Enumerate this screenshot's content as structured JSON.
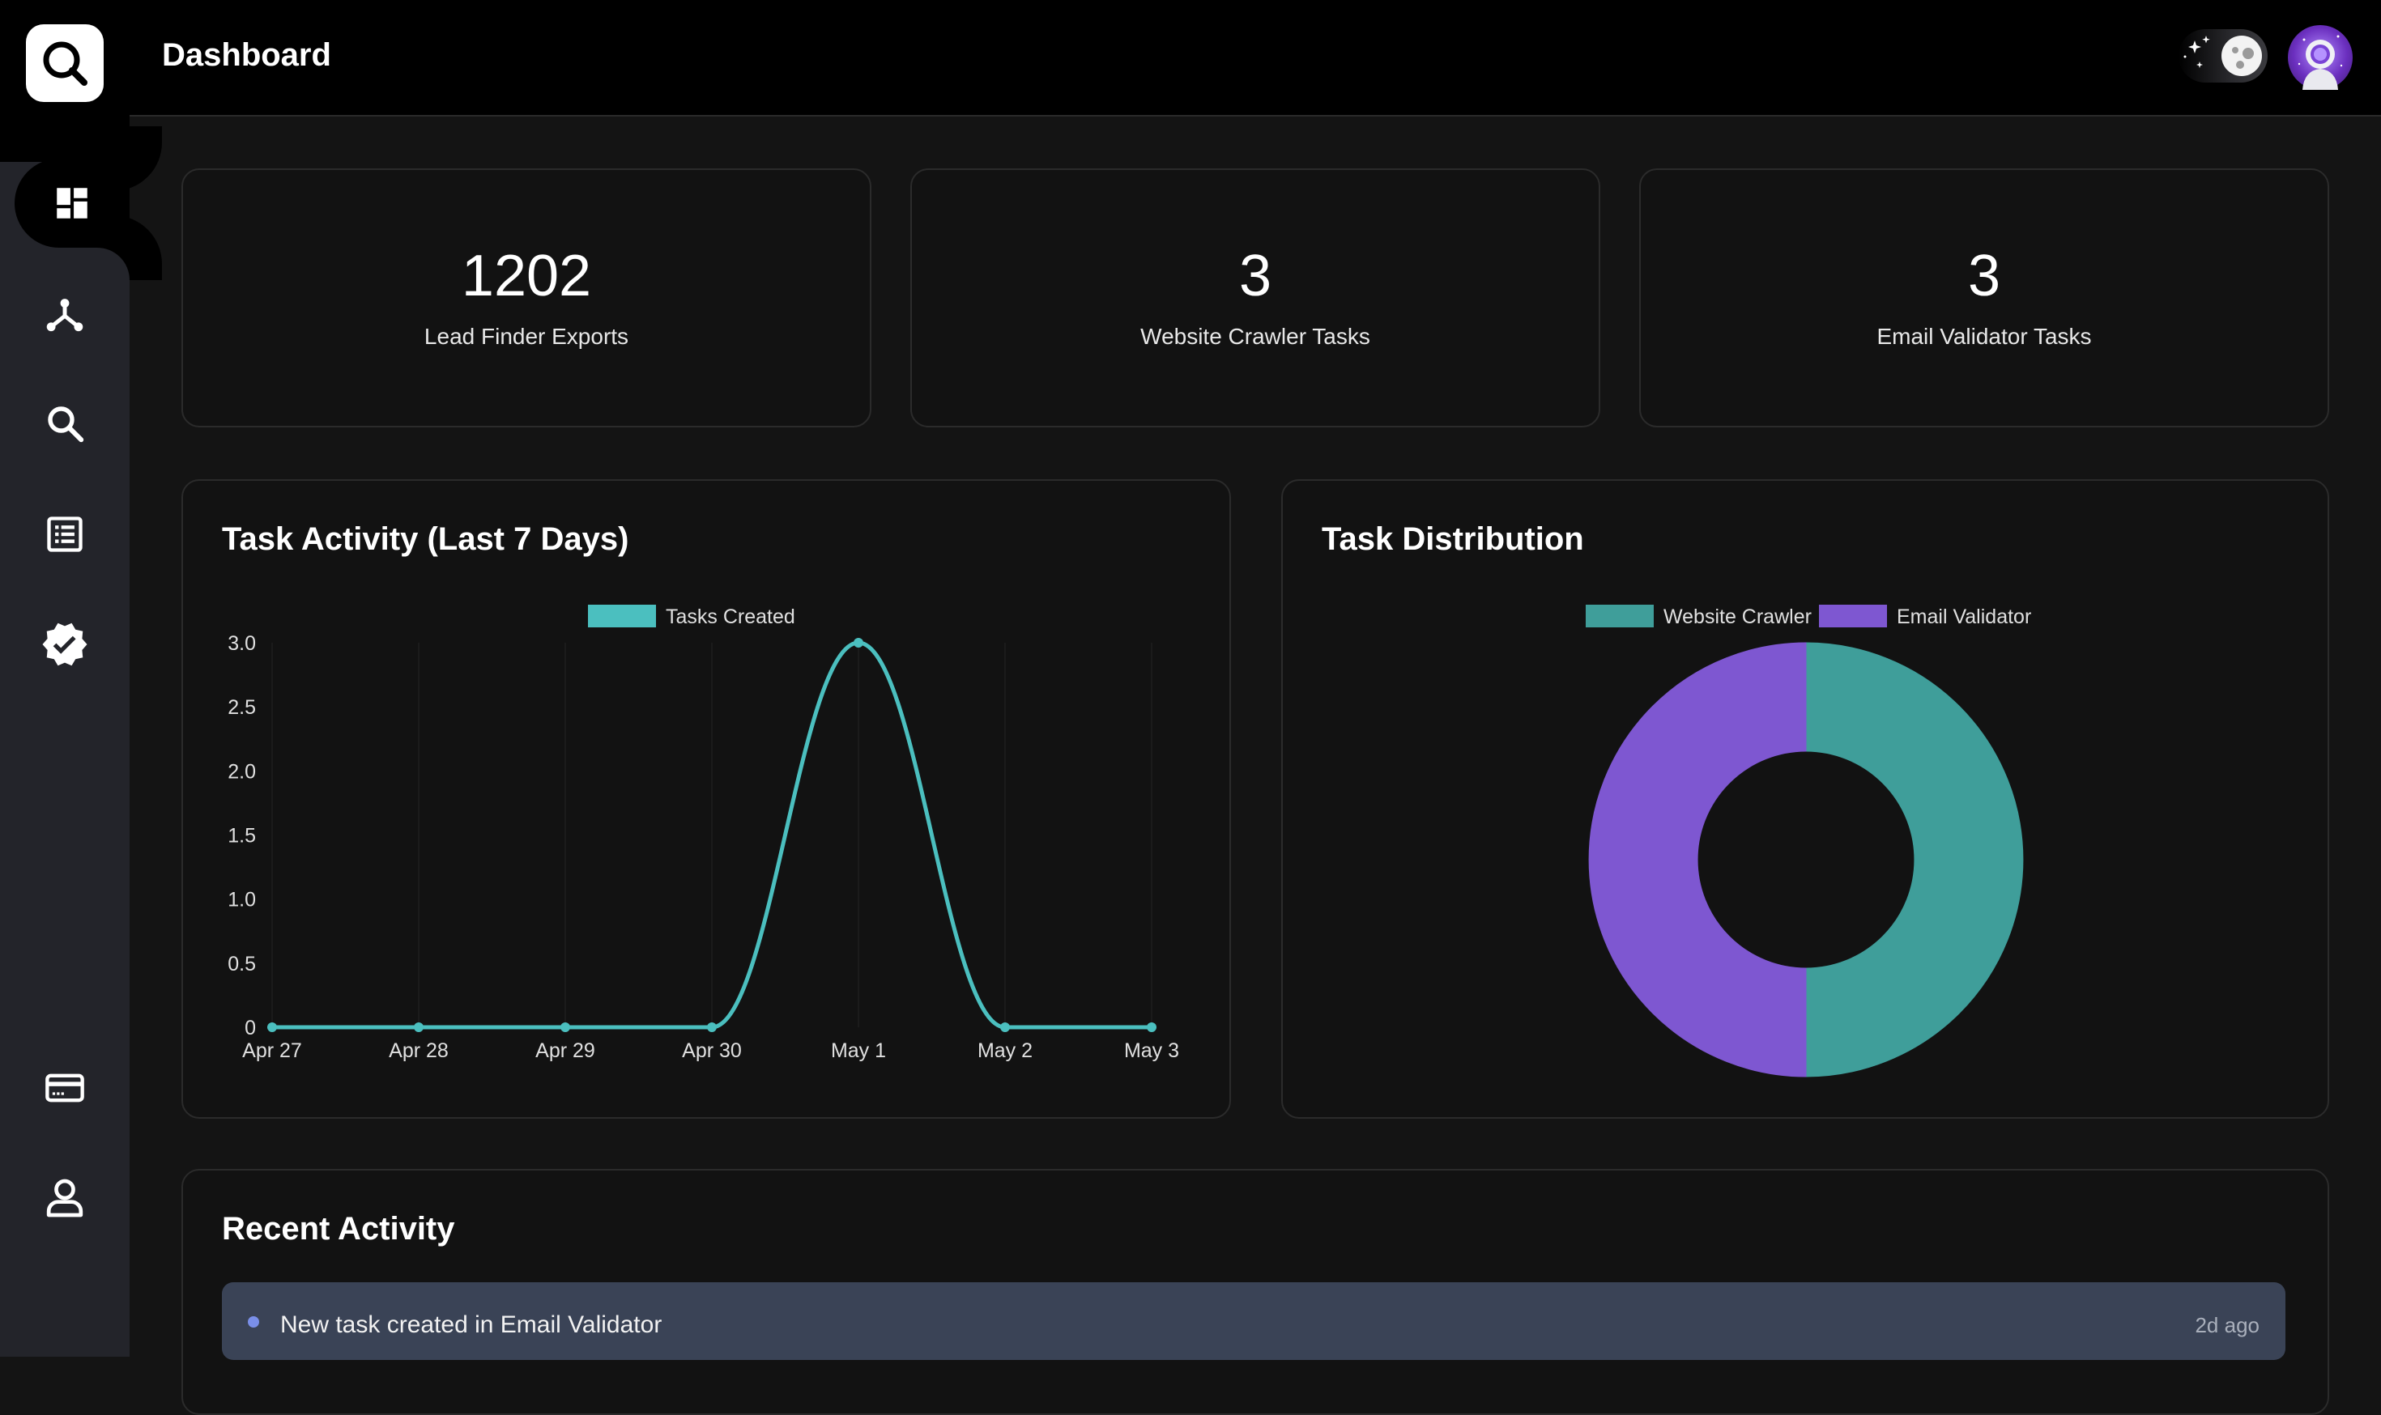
{
  "header": {
    "title": "Dashboard"
  },
  "sidebar": {
    "items": [
      {
        "name": "dashboard",
        "icon": "dashboard-icon",
        "active": true
      },
      {
        "name": "integrations",
        "icon": "network-icon"
      },
      {
        "name": "lead-finder",
        "icon": "search-icon"
      },
      {
        "name": "website-crawler",
        "icon": "list-icon"
      },
      {
        "name": "email-validator",
        "icon": "verified-badge-icon"
      },
      {
        "name": "billing",
        "icon": "credit-card-icon"
      },
      {
        "name": "account",
        "icon": "user-icon"
      }
    ]
  },
  "stats": [
    {
      "value": "1202",
      "label": "Lead Finder Exports"
    },
    {
      "value": "3",
      "label": "Website Crawler Tasks"
    },
    {
      "value": "3",
      "label": "Email Validator Tasks"
    }
  ],
  "activity_chart": {
    "title": "Task Activity (Last 7 Days)"
  },
  "distribution_chart": {
    "title": "Task Distribution"
  },
  "recent": {
    "title": "Recent Activity",
    "items": [
      {
        "text": "New task created in Email Validator",
        "time": "2d ago"
      }
    ]
  },
  "colors": {
    "teal": "#3f9e9a",
    "line": "#4bbfbf",
    "purple": "#7e57d1"
  },
  "chart_data": [
    {
      "type": "line",
      "title": "Task Activity (Last 7 Days)",
      "x": [
        "Apr 27",
        "Apr 28",
        "Apr 29",
        "Apr 30",
        "May 1",
        "May 2",
        "May 3"
      ],
      "series": [
        {
          "name": "Tasks Created",
          "values": [
            0,
            0,
            0,
            0,
            3,
            0,
            0
          ]
        }
      ],
      "yticks": [
        "0",
        "0.5",
        "1.0",
        "1.5",
        "2.0",
        "2.5",
        "3.0"
      ],
      "ylim": [
        0,
        3
      ],
      "legend": "top-center"
    },
    {
      "type": "pie",
      "subtype": "doughnut",
      "title": "Task Distribution",
      "labels": [
        "Website Crawler",
        "Email Validator"
      ],
      "values": [
        3,
        3
      ],
      "legend": "top-center"
    }
  ]
}
